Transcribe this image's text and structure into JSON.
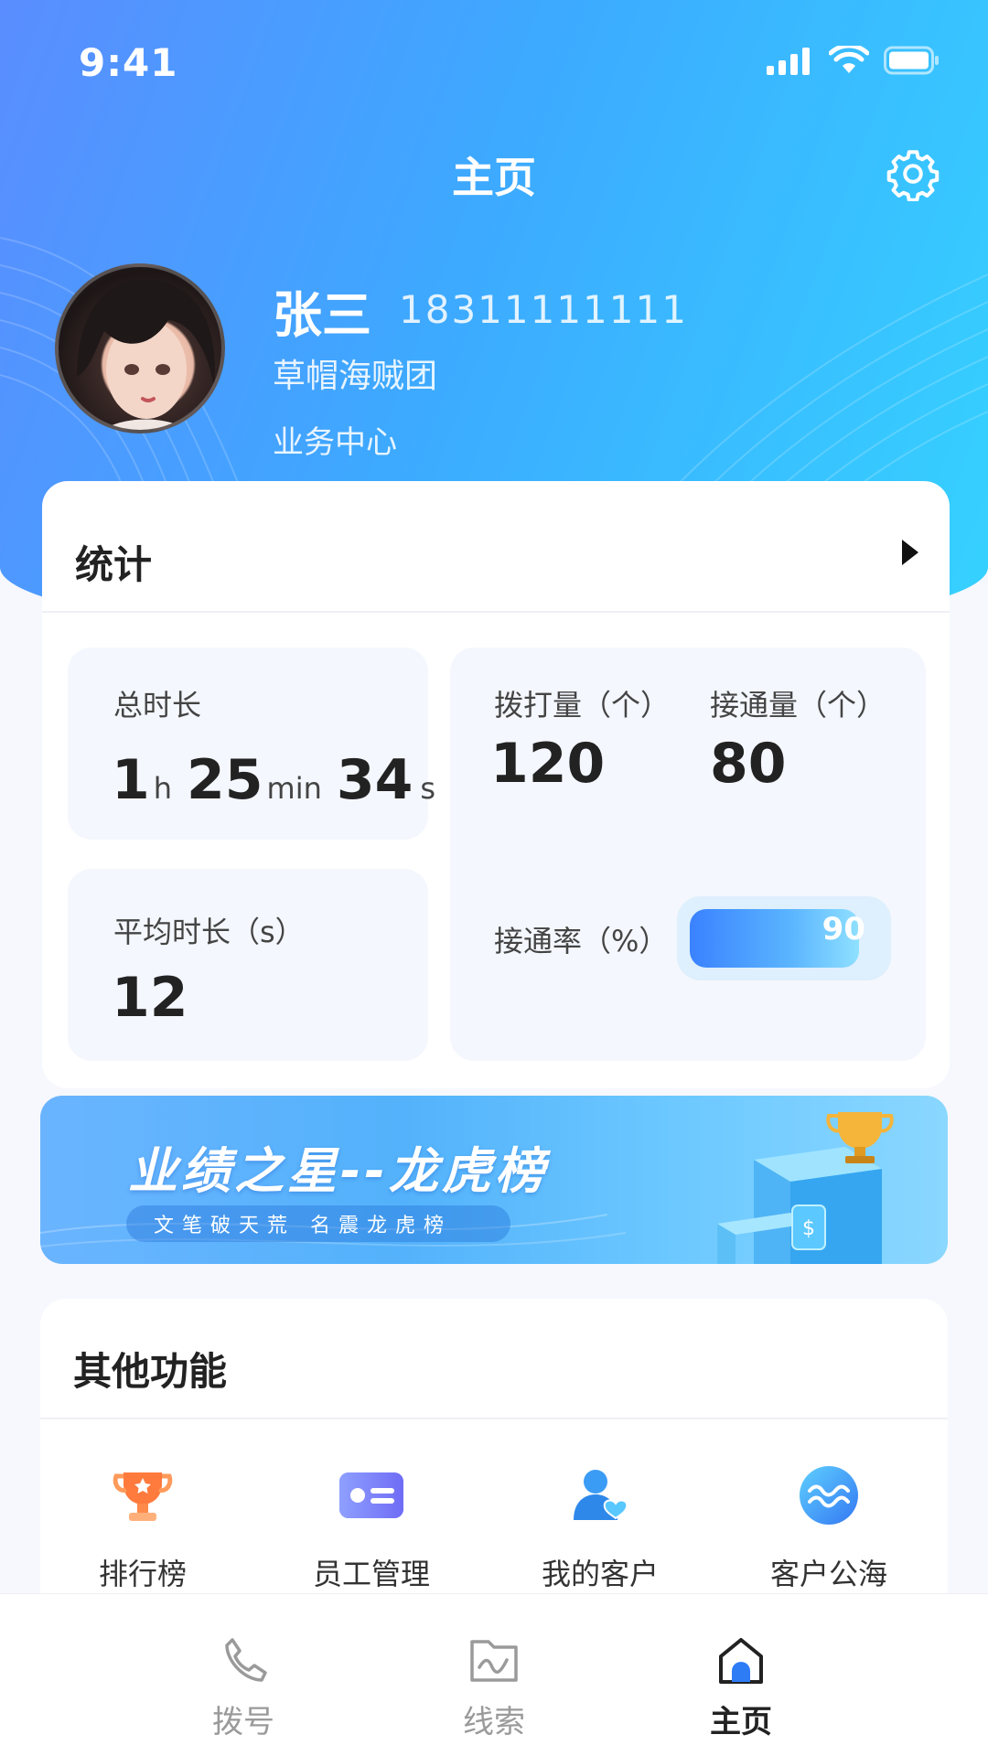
{
  "status_bar": {
    "time": "9:41"
  },
  "header": {
    "title": "主页"
  },
  "profile": {
    "name": "张三",
    "phone": "18311111111",
    "org": "草帽海贼团",
    "dept": "业务中心"
  },
  "stats": {
    "title": "统计",
    "total_duration": {
      "label": "总时长",
      "hours": "1",
      "hours_unit": "h",
      "minutes": "25",
      "minutes_unit": "min",
      "seconds": "34",
      "seconds_unit": "s"
    },
    "avg_duration": {
      "label": "平均时长（s）",
      "value": "12"
    },
    "dial_count": {
      "label": "拨打量（个）",
      "value": "120"
    },
    "connect_count": {
      "label": "接通量（个）",
      "value": "80"
    },
    "connect_rate": {
      "label": "接通率（%）",
      "value": "90",
      "fraction": 0.9
    }
  },
  "banner": {
    "title": "业绩之星--龙虎榜",
    "subtitle": "文笔破天荒  名震龙虎榜"
  },
  "functions": {
    "title": "其他功能",
    "items": [
      {
        "label": "排行榜",
        "icon": "trophy-icon"
      },
      {
        "label": "员工管理",
        "icon": "id-card-icon"
      },
      {
        "label": "我的客户",
        "icon": "user-heart-icon"
      },
      {
        "label": "客户公海",
        "icon": "waves-icon"
      }
    ]
  },
  "tabbar": {
    "items": [
      {
        "label": "拨号",
        "icon": "phone-icon"
      },
      {
        "label": "线索",
        "icon": "folder-wave-icon"
      },
      {
        "label": "主页",
        "icon": "home-icon",
        "active": true
      }
    ]
  },
  "colors": {
    "hero_start": "#5a8dff",
    "hero_end": "#35d2ff",
    "accent": "#3a82ff",
    "trophy": "#ff7a3d"
  }
}
